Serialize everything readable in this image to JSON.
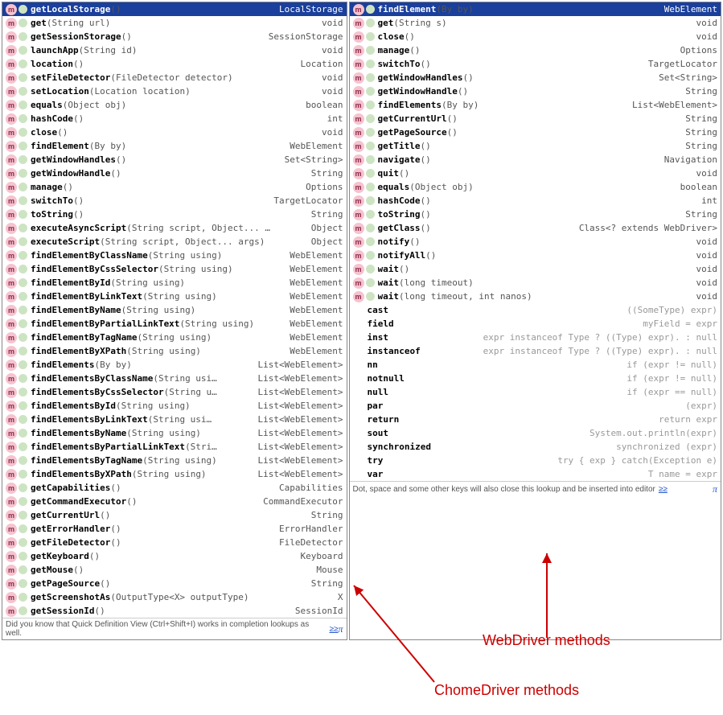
{
  "left": {
    "hint_text": "Did you know that Quick Definition View (Ctrl+Shift+I) works in completion lookups as well.",
    "hint_link": "≥≥",
    "items": [
      {
        "k": "m",
        "name": "getLocalStorage",
        "par": "()",
        "ret": "LocalStorage",
        "hdr": true
      },
      {
        "k": "m",
        "name": "get",
        "par": "(String url)",
        "ret": "void"
      },
      {
        "k": "m",
        "name": "getSessionStorage",
        "par": "()",
        "ret": "SessionStorage"
      },
      {
        "k": "m",
        "name": "launchApp",
        "par": "(String id)",
        "ret": "void"
      },
      {
        "k": "m",
        "name": "location",
        "par": "()",
        "ret": "Location"
      },
      {
        "k": "m",
        "name": "setFileDetector",
        "par": "(FileDetector detector)",
        "ret": "void"
      },
      {
        "k": "m",
        "name": "setLocation",
        "par": "(Location location)",
        "ret": "void"
      },
      {
        "k": "m",
        "name": "equals",
        "par": "(Object obj)",
        "ret": "boolean"
      },
      {
        "k": "m",
        "name": "hashCode",
        "par": "()",
        "ret": "int"
      },
      {
        "k": "m",
        "name": "close",
        "par": "()",
        "ret": "void"
      },
      {
        "k": "m",
        "name": "findElement",
        "par": "(By by)",
        "ret": "WebElement"
      },
      {
        "k": "m",
        "name": "getWindowHandles",
        "par": "()",
        "ret": "Set<String>"
      },
      {
        "k": "m",
        "name": "getWindowHandle",
        "par": "()",
        "ret": "String"
      },
      {
        "k": "m",
        "name": "manage",
        "par": "()",
        "ret": "Options"
      },
      {
        "k": "m",
        "name": "switchTo",
        "par": "()",
        "ret": "TargetLocator"
      },
      {
        "k": "m",
        "name": "toString",
        "par": "()",
        "ret": "String"
      },
      {
        "k": "m",
        "name": "executeAsyncScript",
        "par": "(String script, Object... …",
        "ret": "Object"
      },
      {
        "k": "m",
        "name": "executeScript",
        "par": "(String script, Object... args)",
        "ret": "Object"
      },
      {
        "k": "m",
        "name": "findElementByClassName",
        "par": "(String using)",
        "ret": "WebElement"
      },
      {
        "k": "m",
        "name": "findElementByCssSelector",
        "par": "(String using)",
        "ret": "WebElement"
      },
      {
        "k": "m",
        "name": "findElementById",
        "par": "(String using)",
        "ret": "WebElement"
      },
      {
        "k": "m",
        "name": "findElementByLinkText",
        "par": "(String using)",
        "ret": "WebElement"
      },
      {
        "k": "m",
        "name": "findElementByName",
        "par": "(String using)",
        "ret": "WebElement"
      },
      {
        "k": "m",
        "name": "findElementByPartialLinkText",
        "par": "(String using)",
        "ret": "WebElement"
      },
      {
        "k": "m",
        "name": "findElementByTagName",
        "par": "(String using)",
        "ret": "WebElement"
      },
      {
        "k": "m",
        "name": "findElementByXPath",
        "par": "(String using)",
        "ret": "WebElement"
      },
      {
        "k": "m",
        "name": "findElements",
        "par": "(By by)",
        "ret": "List<WebElement>"
      },
      {
        "k": "m",
        "name": "findElementsByClassName",
        "par": "(String usi…",
        "ret": "List<WebElement>"
      },
      {
        "k": "m",
        "name": "findElementsByCssSelector",
        "par": "(String u…",
        "ret": "List<WebElement>"
      },
      {
        "k": "m",
        "name": "findElementsById",
        "par": "(String using)",
        "ret": "List<WebElement>"
      },
      {
        "k": "m",
        "name": "findElementsByLinkText",
        "par": "(String usi…",
        "ret": "List<WebElement>"
      },
      {
        "k": "m",
        "name": "findElementsByName",
        "par": "(String using)",
        "ret": "List<WebElement>"
      },
      {
        "k": "m",
        "name": "findElementsByPartialLinkText",
        "par": "(Stri…",
        "ret": "List<WebElement>"
      },
      {
        "k": "m",
        "name": "findElementsByTagName",
        "par": "(String using)",
        "ret": "List<WebElement>"
      },
      {
        "k": "m",
        "name": "findElementsByXPath",
        "par": "(String using)",
        "ret": "List<WebElement>"
      },
      {
        "k": "m",
        "name": "getCapabilities",
        "par": "()",
        "ret": "Capabilities"
      },
      {
        "k": "m",
        "name": "getCommandExecutor",
        "par": "()",
        "ret": "CommandExecutor"
      },
      {
        "k": "m",
        "name": "getCurrentUrl",
        "par": "()",
        "ret": "String"
      },
      {
        "k": "m",
        "name": "getErrorHandler",
        "par": "()",
        "ret": "ErrorHandler"
      },
      {
        "k": "m",
        "name": "getFileDetector",
        "par": "()",
        "ret": "FileDetector"
      },
      {
        "k": "m",
        "name": "getKeyboard",
        "par": "()",
        "ret": "Keyboard"
      },
      {
        "k": "m",
        "name": "getMouse",
        "par": "()",
        "ret": "Mouse"
      },
      {
        "k": "m",
        "name": "getPageSource",
        "par": "()",
        "ret": "String"
      },
      {
        "k": "m",
        "name": "getScreenshotAs",
        "par": "(OutputType<X> outputType)",
        "ret": "X"
      },
      {
        "k": "m",
        "name": "getSessionId",
        "par": "()",
        "ret": "SessionId"
      }
    ]
  },
  "right": {
    "hint_text": "Dot, space and some other keys will also close this lookup and be inserted into editor",
    "hint_link": "≥≥",
    "items": [
      {
        "k": "m",
        "name": "findElement",
        "par": "(By by)",
        "ret": "WebElement",
        "hdr": true
      },
      {
        "k": "m",
        "name": "get",
        "par": "(String s)",
        "ret": "void"
      },
      {
        "k": "m",
        "name": "close",
        "par": "()",
        "ret": "void"
      },
      {
        "k": "m",
        "name": "manage",
        "par": "()",
        "ret": "Options"
      },
      {
        "k": "m",
        "name": "switchTo",
        "par": "()",
        "ret": "TargetLocator"
      },
      {
        "k": "m",
        "name": "getWindowHandles",
        "par": "()",
        "ret": "Set<String>"
      },
      {
        "k": "m",
        "name": "getWindowHandle",
        "par": "()",
        "ret": "String"
      },
      {
        "k": "m",
        "name": "findElements",
        "par": "(By by)",
        "ret": "List<WebElement>"
      },
      {
        "k": "m",
        "name": "getCurrentUrl",
        "par": "()",
        "ret": "String"
      },
      {
        "k": "m",
        "name": "getPageSource",
        "par": "()",
        "ret": "String"
      },
      {
        "k": "m",
        "name": "getTitle",
        "par": "()",
        "ret": "String"
      },
      {
        "k": "m",
        "name": "navigate",
        "par": "()",
        "ret": "Navigation"
      },
      {
        "k": "m",
        "name": "quit",
        "par": "()",
        "ret": "void"
      },
      {
        "k": "m",
        "name": "equals",
        "par": "(Object obj)",
        "ret": "boolean"
      },
      {
        "k": "m",
        "name": "hashCode",
        "par": "()",
        "ret": "int"
      },
      {
        "k": "m",
        "name": "toString",
        "par": "()",
        "ret": "String"
      },
      {
        "k": "m",
        "name": "getClass",
        "par": "()",
        "ret": "Class<? extends WebDriver>"
      },
      {
        "k": "m",
        "name": "notify",
        "par": "()",
        "ret": "void"
      },
      {
        "k": "m",
        "name": "notifyAll",
        "par": "()",
        "ret": "void"
      },
      {
        "k": "m",
        "name": "wait",
        "par": "()",
        "ret": "void"
      },
      {
        "k": "m",
        "name": "wait",
        "par": "(long timeout)",
        "ret": "void"
      },
      {
        "k": "m",
        "name": "wait",
        "par": "(long timeout, int nanos)",
        "ret": "void"
      },
      {
        "k": "t",
        "name": "cast",
        "ret": "((SomeType) expr)"
      },
      {
        "k": "t",
        "name": "field",
        "ret": "myField = expr"
      },
      {
        "k": "t",
        "name": "inst",
        "ret": "expr instanceof Type ? ((Type) expr). : null"
      },
      {
        "k": "t",
        "name": "instanceof",
        "ret": "expr instanceof Type ? ((Type) expr). : null"
      },
      {
        "k": "t",
        "name": "nn",
        "ret": "if (expr != null)"
      },
      {
        "k": "t",
        "name": "notnull",
        "ret": "if (expr != null)"
      },
      {
        "k": "t",
        "name": "null",
        "ret": "if (expr == null)"
      },
      {
        "k": "t",
        "name": "par",
        "ret": "(expr)"
      },
      {
        "k": "t",
        "name": "return",
        "ret": "return expr"
      },
      {
        "k": "t",
        "name": "sout",
        "ret": "System.out.println(expr)"
      },
      {
        "k": "t",
        "name": "synchronized",
        "ret": "synchronized (expr)"
      },
      {
        "k": "t",
        "name": "try",
        "ret": "try { exp } catch(Exception e)"
      },
      {
        "k": "t",
        "name": "var",
        "ret": "T name = expr"
      }
    ]
  },
  "labels": {
    "webdriver": "WebDriver methods",
    "chromedriver": "ChomeDriver methods"
  }
}
